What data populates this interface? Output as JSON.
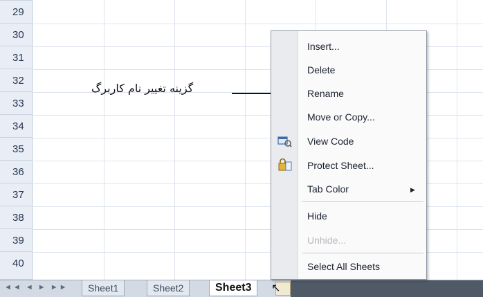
{
  "rows": [
    "29",
    "30",
    "31",
    "32",
    "33",
    "34",
    "35",
    "36",
    "37",
    "38",
    "39",
    "40"
  ],
  "tabs": {
    "nav": "◄◄ ◄ ► ►►",
    "sheet1": "Sheet1",
    "sheet2": "Sheet2",
    "sheet3": "Sheet3"
  },
  "context_menu": {
    "insert": "Insert...",
    "delete": "Delete",
    "rename": "Rename",
    "move_copy": "Move or Copy...",
    "view_code": "View Code",
    "protect_sheet": "Protect Sheet...",
    "tab_color": "Tab Color",
    "hide": "Hide",
    "unhide": "Unhide...",
    "select_all": "Select All Sheets"
  },
  "annotation": "گزینه تغییر نام کاربرگ",
  "colors": {
    "arrow": "#111111",
    "menu_bg": "#fafafa",
    "gutter": "#e9ebee"
  }
}
